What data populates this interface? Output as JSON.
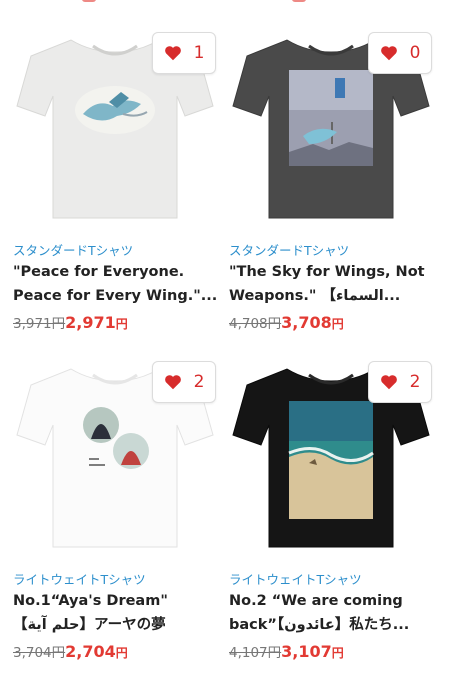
{
  "colors": {
    "accent": "#e23a33",
    "category": "#2d8fcc"
  },
  "products": [
    {
      "likes": "1",
      "category": "スタンダードTシャツ",
      "title_line1": "\"Peace for Everyone.",
      "title_line2": "Peace for Every Wing.\"...",
      "old_price": "3,971円",
      "new_price": "2,971",
      "currency": "円",
      "shirt_color": "#ececec"
    },
    {
      "likes": "0",
      "category": "スタンダードTシャツ",
      "title_line1": "\"The Sky for Wings, Not",
      "title_line2": "Weapons.\" 【السماء...",
      "old_price": "4,708円",
      "new_price": "3,708",
      "currency": "円",
      "shirt_color": "#4a4a4a"
    },
    {
      "likes": "2",
      "category": "ライトウェイトTシャツ",
      "title_line1": "No.1“Aya's Dream\"",
      "title_line2": "【حلم آية】アーヤの夢",
      "old_price": "3,704円",
      "new_price": "2,704",
      "currency": "円",
      "shirt_color": "#fafafa"
    },
    {
      "likes": "2",
      "category": "ライトウェイトTシャツ",
      "title_line1": "No.2 “We are coming",
      "title_line2": "back”【عائدون】私たち...",
      "old_price": "4,107円",
      "new_price": "3,107",
      "currency": "円",
      "shirt_color": "#151515"
    }
  ]
}
